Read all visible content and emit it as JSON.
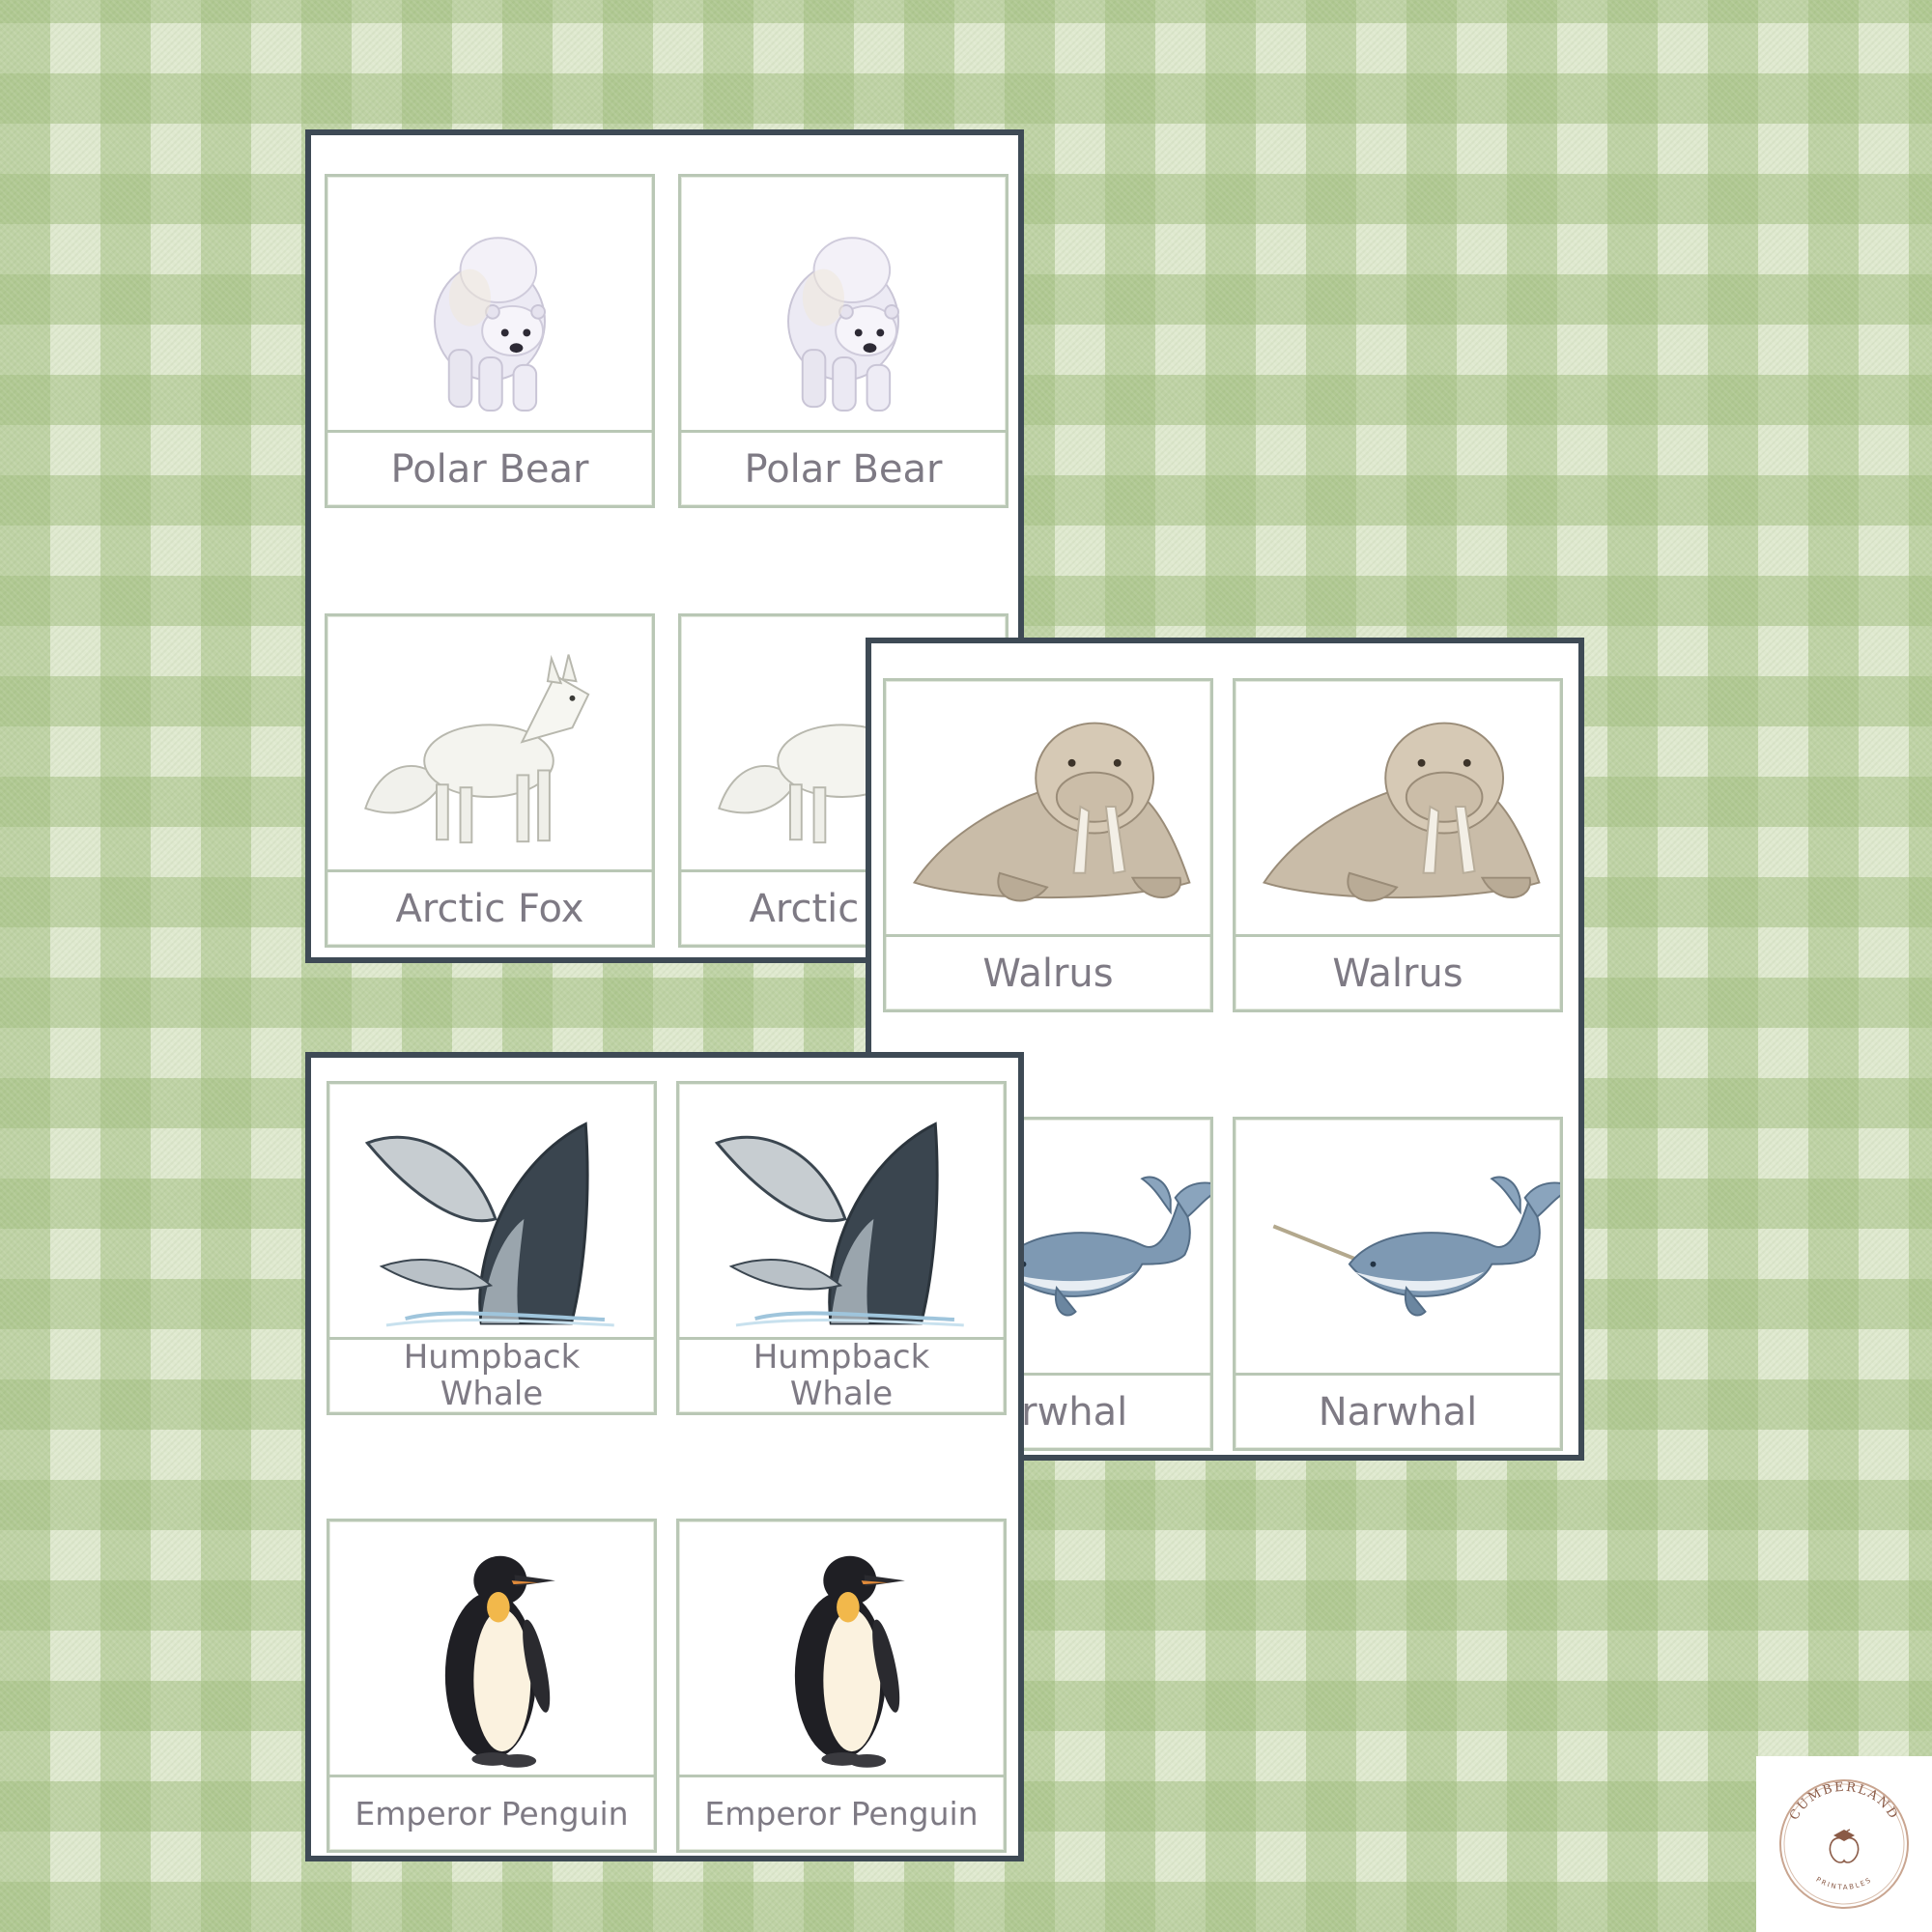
{
  "sheets": [
    {
      "cards": [
        {
          "label": "Polar Bear",
          "image": "polar-bear"
        },
        {
          "label": "Polar Bear",
          "image": "polar-bear"
        },
        {
          "label": "Arctic Fox",
          "image": "arctic-fox"
        },
        {
          "label": "Arctic Fox",
          "image": "arctic-fox"
        }
      ]
    },
    {
      "cards": [
        {
          "label": "Walrus",
          "image": "walrus"
        },
        {
          "label": "Walrus",
          "image": "walrus"
        },
        {
          "label": "Narwhal",
          "image": "narwhal"
        },
        {
          "label": "Narwhal",
          "image": "narwhal"
        }
      ]
    },
    {
      "cards": [
        {
          "label_line1": "Humpback",
          "label_line2": "Whale",
          "image": "humpback-whale"
        },
        {
          "label_line1": "Humpback",
          "label_line2": "Whale",
          "image": "humpback-whale"
        },
        {
          "label": "Emperor Penguin",
          "image": "emperor-penguin"
        },
        {
          "label": "Emperor Penguin",
          "image": "emperor-penguin"
        }
      ]
    }
  ],
  "logo": {
    "top_text": "CUMBERLAND",
    "bottom_text": "PRINTABLES",
    "icon": "apple-icon"
  },
  "colors": {
    "gingham_light": "#dfe9cf",
    "gingham_dark": "#a4c082",
    "sheet_border": "#3e4a55",
    "card_border": "#b9c7b5",
    "label_text": "#7e7a84"
  }
}
